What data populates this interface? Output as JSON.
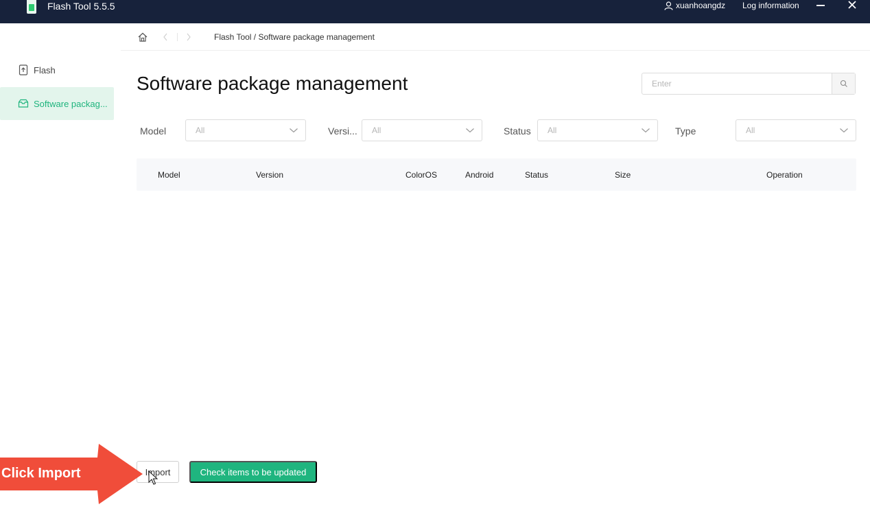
{
  "titlebar": {
    "app_title": "Flash Tool 5.5.5",
    "username": "xuanhoangdz",
    "log_information": "Log information"
  },
  "sidebar": {
    "items": [
      {
        "label": "Flash",
        "icon": "upload-file-icon",
        "active": false
      },
      {
        "label": "Software packag...",
        "icon": "package-icon",
        "active": true
      }
    ]
  },
  "breadcrumb": {
    "text": "Flash Tool / Software package management"
  },
  "page": {
    "title": "Software package management",
    "search_placeholder": "Enter"
  },
  "filters": [
    {
      "label": "Model",
      "value": "All"
    },
    {
      "label": "Versi...",
      "value": "All"
    },
    {
      "label": "Status",
      "value": "All"
    },
    {
      "label": "Type",
      "value": "All"
    }
  ],
  "table": {
    "columns": [
      "Model",
      "Version",
      "ColorOS",
      "Android",
      "Status",
      "Size",
      "Operation"
    ]
  },
  "actions": {
    "import_label": "Import",
    "check_label": "Check items to be updated"
  },
  "annotation": {
    "text": "Click Import"
  },
  "colors": {
    "titlebar_bg": "#17223b",
    "accent_green": "#1fb57f",
    "active_nav_bg": "#e3f5ec",
    "arrow_red": "#f04d3a"
  }
}
